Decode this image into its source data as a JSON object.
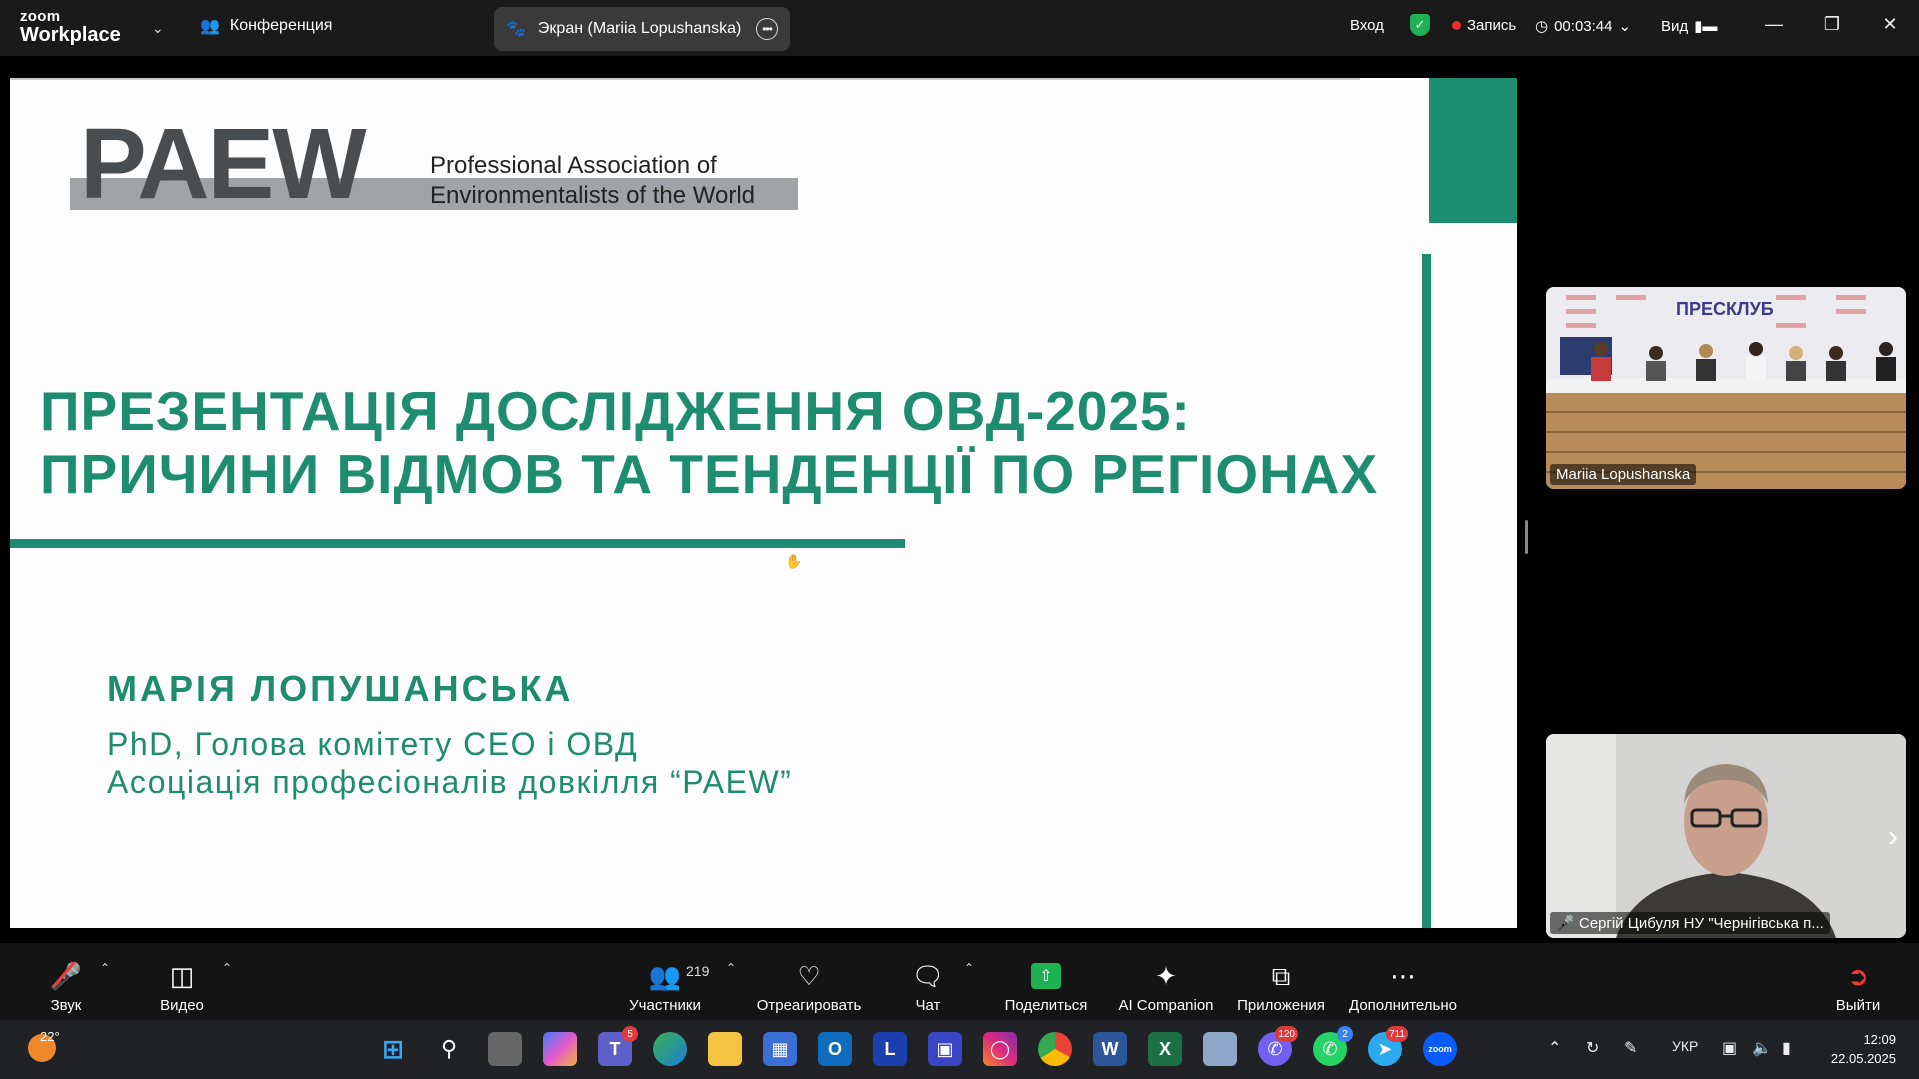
{
  "titlebar": {
    "logo_top": "zoom",
    "logo_bottom": "Workplace",
    "conference_label": "Конференция",
    "share_pill_label": "Экран (Mariia Lopushanska)",
    "login_label": "Вход",
    "recording_label": "Запись",
    "timer": "00:03:44",
    "view_label": "Вид"
  },
  "slide": {
    "logo_text": "PAEW",
    "logo_sub_line1": "Professional Association of",
    "logo_sub_line2": "Environmentalists of the World",
    "title_line1": "ПРЕЗЕНТАЦІЯ ДОСЛІДЖЕННЯ ОВД-2025:",
    "title_line2": "ПРИЧИНИ ВІДМОВ ТА ТЕНДЕНЦІЇ ПО РЕГІОНАХ",
    "presenter_name": "МАРІЯ ЛОПУШАНСЬКА",
    "presenter_role_line1": "PhD, Голова комітету СЕО і ОВД",
    "presenter_role_line2": "Асоціація професіоналів довкілля “PAEW”",
    "accent_color": "#1e8c6e"
  },
  "participants": [
    {
      "name": "Mariia Lopushanska",
      "muted": false,
      "banner_text": "ПРЕСКЛУБ"
    },
    {
      "name": "Сергій Цибуля НУ \"Чернігівська п...",
      "muted": true
    }
  ],
  "toolbar": {
    "audio_label": "Звук",
    "video_label": "Видео",
    "participants_label": "Участники",
    "participants_count": "219",
    "react_label": "Отреагировать",
    "chat_label": "Чат",
    "share_label": "Поделиться",
    "ai_label": "AI Companion",
    "apps_label": "Приложения",
    "more_label": "Дополнительно",
    "leave_label": "Выйти"
  },
  "taskbar": {
    "weather_temp": "22°",
    "apps": [
      {
        "name": "start",
        "badge": ""
      },
      {
        "name": "search",
        "badge": ""
      },
      {
        "name": "task-view",
        "badge": ""
      },
      {
        "name": "copilot",
        "badge": ""
      },
      {
        "name": "teams",
        "badge": "5"
      },
      {
        "name": "edge",
        "badge": ""
      },
      {
        "name": "file-explorer",
        "badge": ""
      },
      {
        "name": "store",
        "badge": ""
      },
      {
        "name": "outlook",
        "badge": ""
      },
      {
        "name": "l-app",
        "badge": ""
      },
      {
        "name": "save-app",
        "badge": ""
      },
      {
        "name": "instagram",
        "badge": ""
      },
      {
        "name": "chrome",
        "badge": ""
      },
      {
        "name": "word",
        "badge": ""
      },
      {
        "name": "excel",
        "badge": ""
      },
      {
        "name": "notepad",
        "badge": ""
      },
      {
        "name": "viber",
        "badge": "120"
      },
      {
        "name": "whatsapp",
        "badge": "2"
      },
      {
        "name": "telegram",
        "badge": "711"
      },
      {
        "name": "zoom",
        "badge": ""
      }
    ],
    "language": "УКР",
    "time": "12:09",
    "date": "22.05.2025"
  }
}
